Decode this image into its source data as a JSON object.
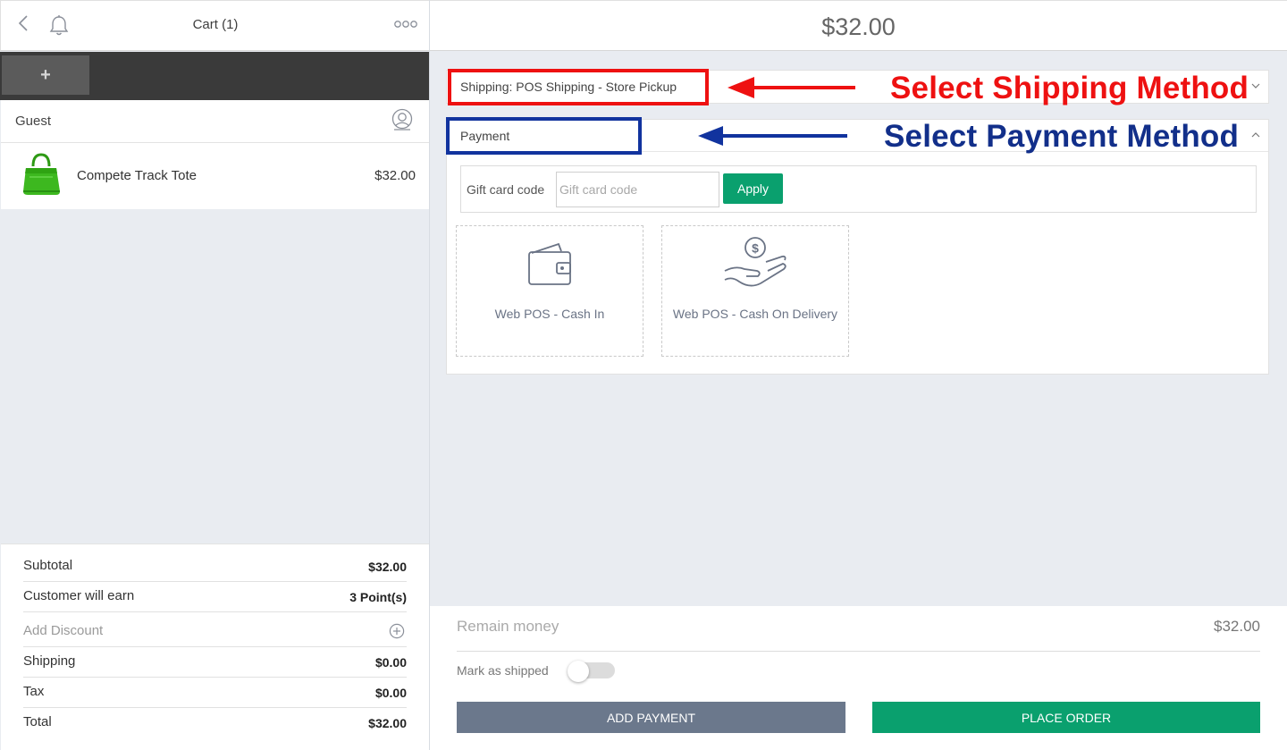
{
  "header": {
    "cart_title": "Cart (1)",
    "back_icon": "chevron-left-icon",
    "bell_icon": "bell-icon",
    "more_icon": "ellipsis-icon"
  },
  "tabs": {
    "add_label": "+"
  },
  "customer": {
    "name": "Guest",
    "icon": "user-icon"
  },
  "cart_items": [
    {
      "name": "Compete Track Tote",
      "price": "$32.00",
      "thumb_color": "#3db81f"
    }
  ],
  "totals": {
    "subtotal_label": "Subtotal",
    "subtotal": "$32.00",
    "earn_label": "Customer will earn",
    "earn": "3 Point(s)",
    "discount_label": "Add Discount",
    "shipping_label": "Shipping",
    "shipping": "$0.00",
    "tax_label": "Tax",
    "tax": "$0.00",
    "total_label": "Total",
    "total": "$32.00"
  },
  "checkout": {
    "grand_total": "$32.00",
    "shipping_method": "Shipping: POS Shipping - Store Pickup",
    "payment_label": "Payment",
    "gift_card_label": "Gift card code",
    "gift_card_placeholder": "Gift card code",
    "gift_card_value": "",
    "apply_label": "Apply",
    "payment_methods": [
      {
        "label": "Web POS - Cash In",
        "icon": "wallet-icon"
      },
      {
        "label": "Web POS - Cash On Delivery",
        "icon": "hand-coin-icon"
      }
    ]
  },
  "footer": {
    "remain_label": "Remain money",
    "remain_value": "$32.00",
    "mark_shipped_label": "Mark as shipped",
    "mark_shipped": false,
    "add_payment_label": "ADD PAYMENT",
    "place_order_label": "PLACE ORDER"
  },
  "annotations": {
    "shipping_text": "Select Shipping Method",
    "payment_text": "Select Payment Method",
    "shipping_color": "#ee1111",
    "payment_color": "#122f8a"
  },
  "colors": {
    "accent_green": "#0aa06e",
    "secondary_button": "#6b788c",
    "tab_bar": "#3a3a3a",
    "background": "#e9ecf1"
  }
}
